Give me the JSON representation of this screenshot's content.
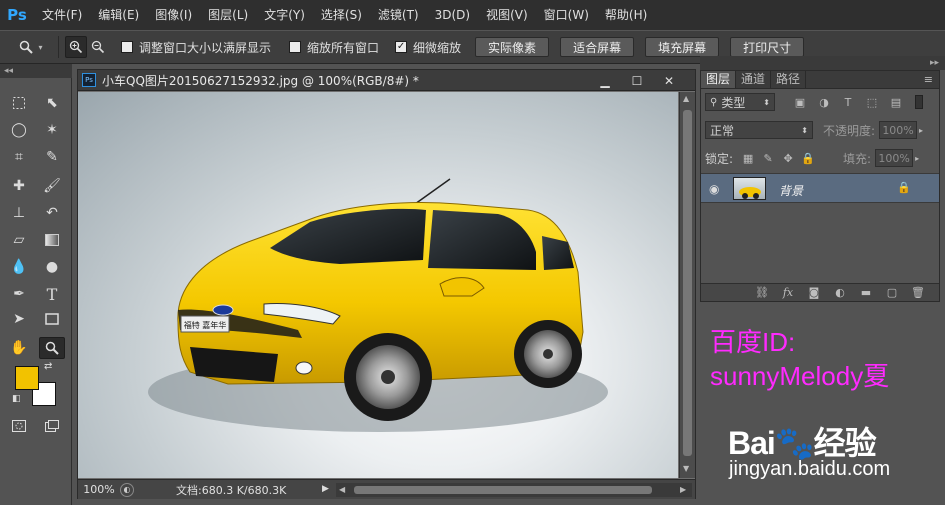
{
  "app": {
    "logo": "Ps"
  },
  "menu": [
    "文件(F)",
    "编辑(E)",
    "图像(I)",
    "图层(L)",
    "文字(Y)",
    "选择(S)",
    "滤镜(T)",
    "3D(D)",
    "视图(V)",
    "窗口(W)",
    "帮助(H)"
  ],
  "window_controls": {
    "minimize": "—",
    "maximize": "☐",
    "close": "✕"
  },
  "options_bar": {
    "resize_windows": {
      "label": "调整窗口大小以满屏显示",
      "checked": false
    },
    "zoom_all_windows": {
      "label": "缩放所有窗口",
      "checked": false
    },
    "scrubby_zoom": {
      "label": "细微缩放",
      "checked": true
    },
    "actual_pixels": "实际像素",
    "fit_screen": "适合屏幕",
    "fill_screen": "填充屏幕",
    "print_size": "打印尺寸"
  },
  "toolbox": {
    "collapse": "◂◂",
    "foreground_color": "#f2c200",
    "background_color": "#ffffff"
  },
  "document": {
    "title": "小车QQ图片20150627152932.jpg @ 100%(RGB/8#) *",
    "zoom": "100%",
    "doc_info": "文档:680.3 K/680.3K",
    "badge_text": "福特 嘉年华"
  },
  "layers_panel": {
    "collapse": "▸▸",
    "tabs": [
      "图层",
      "通道",
      "路径"
    ],
    "filter_label": "类型",
    "blend_mode": "正常",
    "opacity_label": "不透明度:",
    "opacity_value": "100%",
    "lock_label": "锁定:",
    "fill_label": "填充:",
    "fill_value": "100%",
    "layers": [
      {
        "name": "背景",
        "locked": true,
        "visible": true
      }
    ]
  },
  "watermark": {
    "id_line1": "百度ID:",
    "id_line2": "sunnyMelody夏",
    "brand": "Bai🐾经验",
    "site": "jingyan.baidu.com",
    "color": "#ff2aff"
  }
}
